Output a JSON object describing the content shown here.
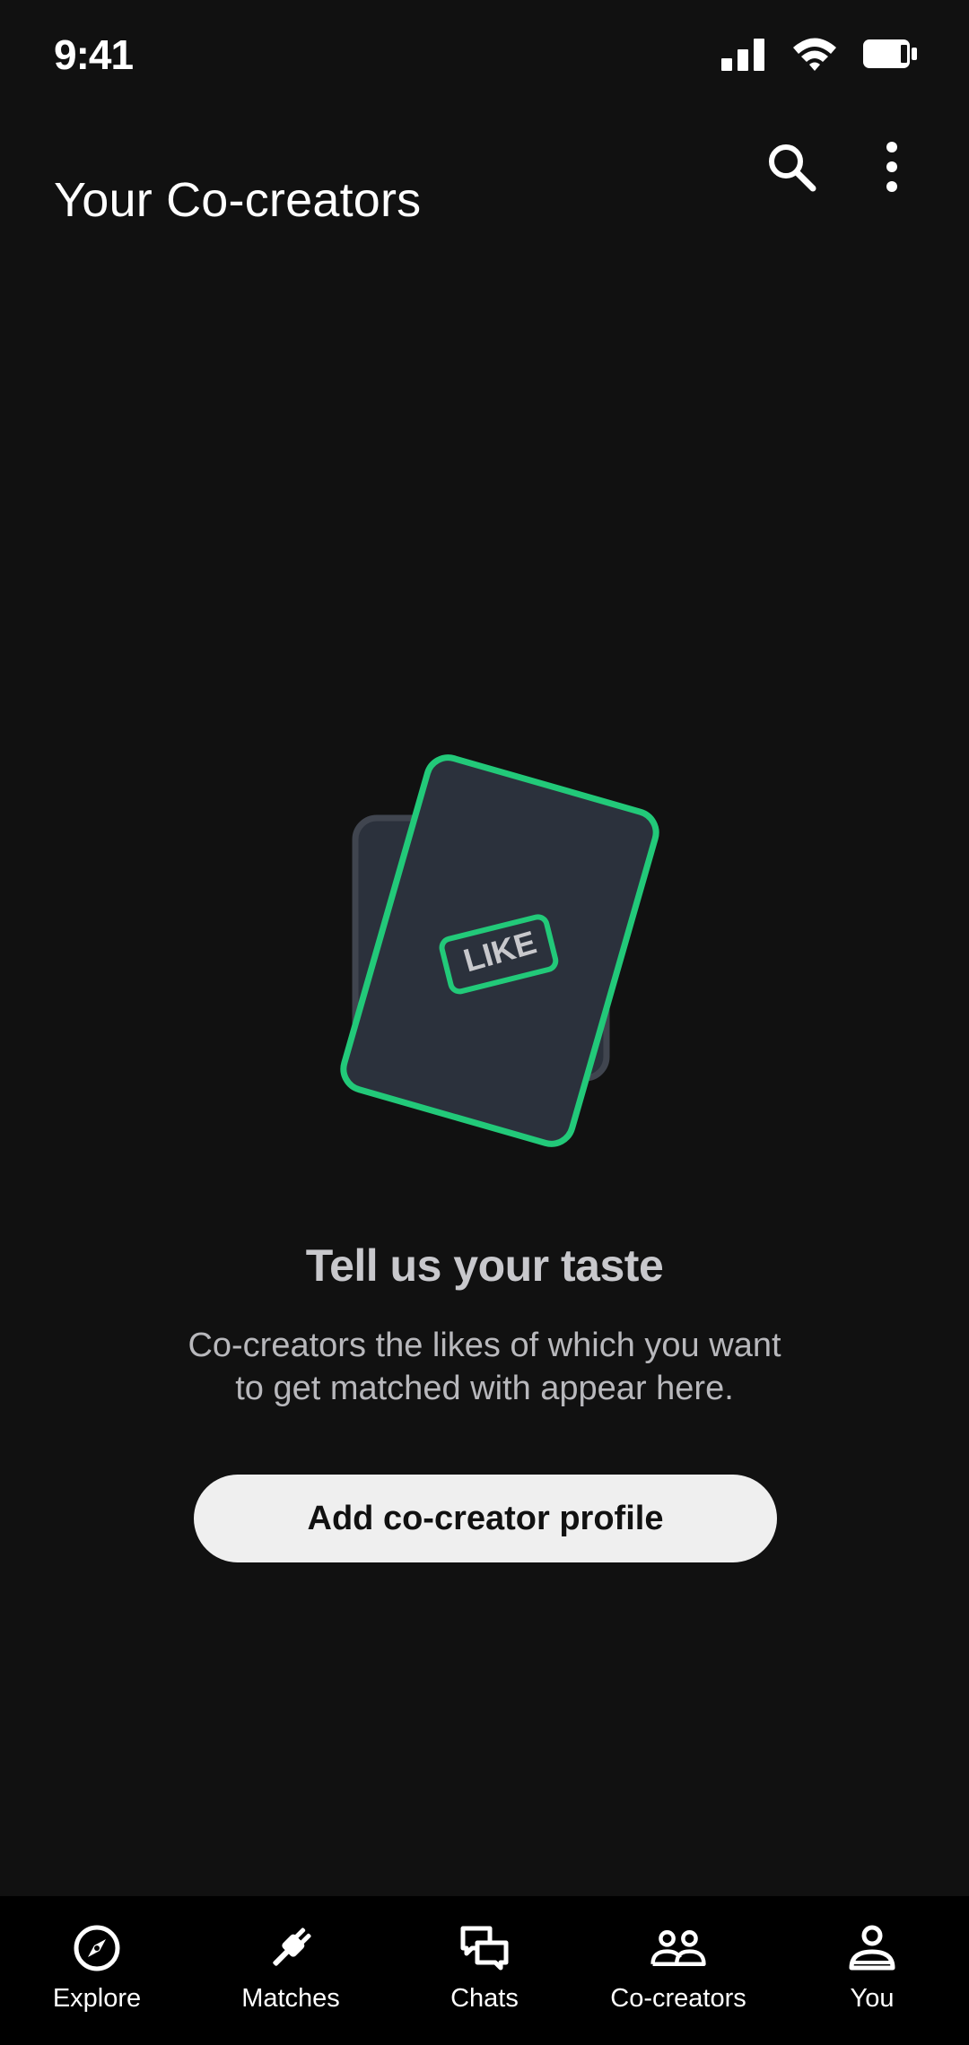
{
  "status_bar": {
    "time": "9:41",
    "icons": [
      "signal-icon",
      "wifi-icon",
      "battery-icon"
    ]
  },
  "header": {
    "title": "Your Co-creators",
    "actions": [
      "search-icon",
      "more-vertical-icon"
    ]
  },
  "empty_state": {
    "illustration_badge": "LIKE",
    "title": "Tell us your taste",
    "description": "Co-creators the likes of which you want to get matched with appear here.",
    "button_label": "Add co-creator profile"
  },
  "bottom_nav": {
    "items": [
      {
        "label": "Explore",
        "icon": "compass-icon"
      },
      {
        "label": "Matches",
        "icon": "plug-icon"
      },
      {
        "label": "Chats",
        "icon": "chat-bubbles-icon"
      },
      {
        "label": "Co-creators",
        "icon": "people-icon"
      },
      {
        "label": "You",
        "icon": "person-icon"
      }
    ]
  },
  "colors": {
    "background": "#111111",
    "nav_background": "#000000",
    "accent_green": "#22c979",
    "card_fill": "#2b313c",
    "button_bg": "#efefef"
  }
}
